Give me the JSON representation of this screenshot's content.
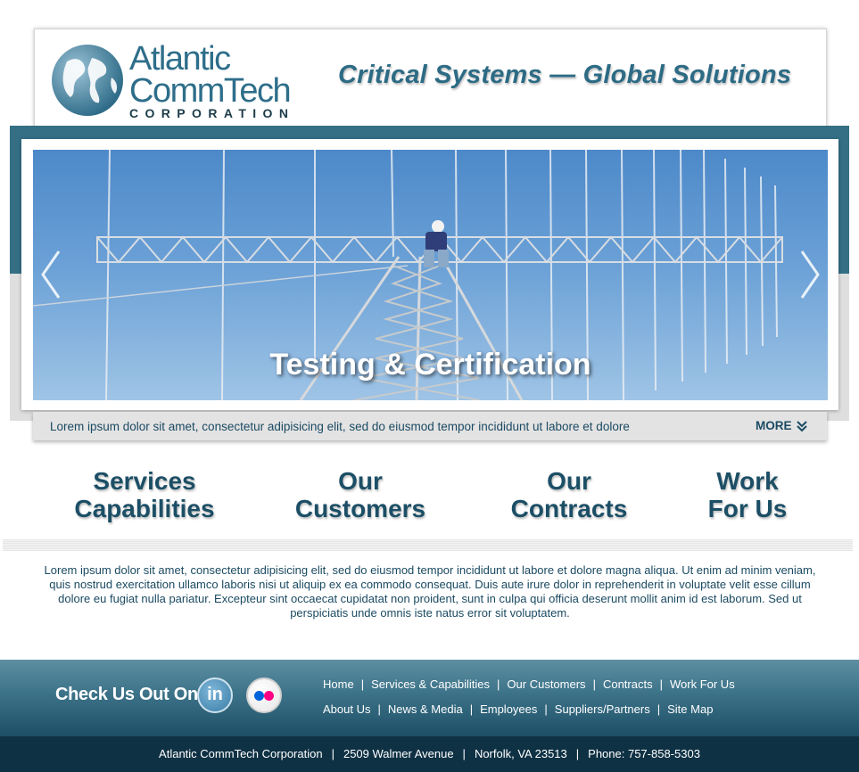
{
  "header": {
    "logo": {
      "line1": "Atlantic",
      "line2": "CommTech",
      "line3": "CORPORATION"
    },
    "tagline": "Critical Systems  —  Global Solutions"
  },
  "slider": {
    "caption": "Testing & Certification",
    "excerpt": "Lorem ipsum dolor sit amet, consectetur adipisicing elit, sed do eiusmod tempor incididunt ut labore et dolore",
    "more_label": "MORE"
  },
  "nav": [
    {
      "line1": "Services",
      "line2": "Capabilities"
    },
    {
      "line1": "Our",
      "line2": "Customers"
    },
    {
      "line1": "Our",
      "line2": "Contracts"
    },
    {
      "line1": "Work",
      "line2": "For Us"
    }
  ],
  "body_text": "Lorem ipsum dolor sit amet, consectetur adipisicing elit, sed do eiusmod tempor incididunt ut labore et dolore magna aliqua. Ut enim ad minim veniam, quis nostrud exercitation ullamco laboris nisi ut aliquip ex ea commodo consequat. Duis aute irure dolor in reprehenderit in voluptate velit esse cillum dolore eu fugiat nulla pariatur. Excepteur sint occaecat cupidatat non proident, sunt in culpa qui officia deserunt mollit anim id est laborum. Sed ut perspiciatis unde omnis iste natus error sit voluptatem.",
  "footer": {
    "check_label": "Check Us Out On:",
    "linkedin_text": "in",
    "links_row1": [
      "Home",
      "Services & Capabilities",
      "Our Customers",
      "Contracts",
      "Work For Us"
    ],
    "links_row2": [
      "About Us",
      "News & Media",
      "Employees",
      "Suppliers/Partners",
      "Site Map"
    ],
    "separator": "|",
    "address": {
      "company": "Atlantic CommTech Corporation",
      "street": "2509 Walmer Avenue",
      "city": "Norfolk, VA  23513",
      "phone": "Phone:  757-858-5303"
    }
  },
  "colors": {
    "brand_teal": "#346f85",
    "brand_text": "#1c4f66",
    "footer_dark": "#0f3144",
    "flickr_blue": "#0063dc",
    "flickr_pink": "#ff0084"
  },
  "icons": {
    "left_arrow": "chevron-left-icon",
    "right_arrow": "chevron-right-icon",
    "more": "double-chevron-down-icon",
    "linkedin": "linkedin-icon",
    "flickr": "flickr-icon",
    "globe": "globe-icon"
  }
}
